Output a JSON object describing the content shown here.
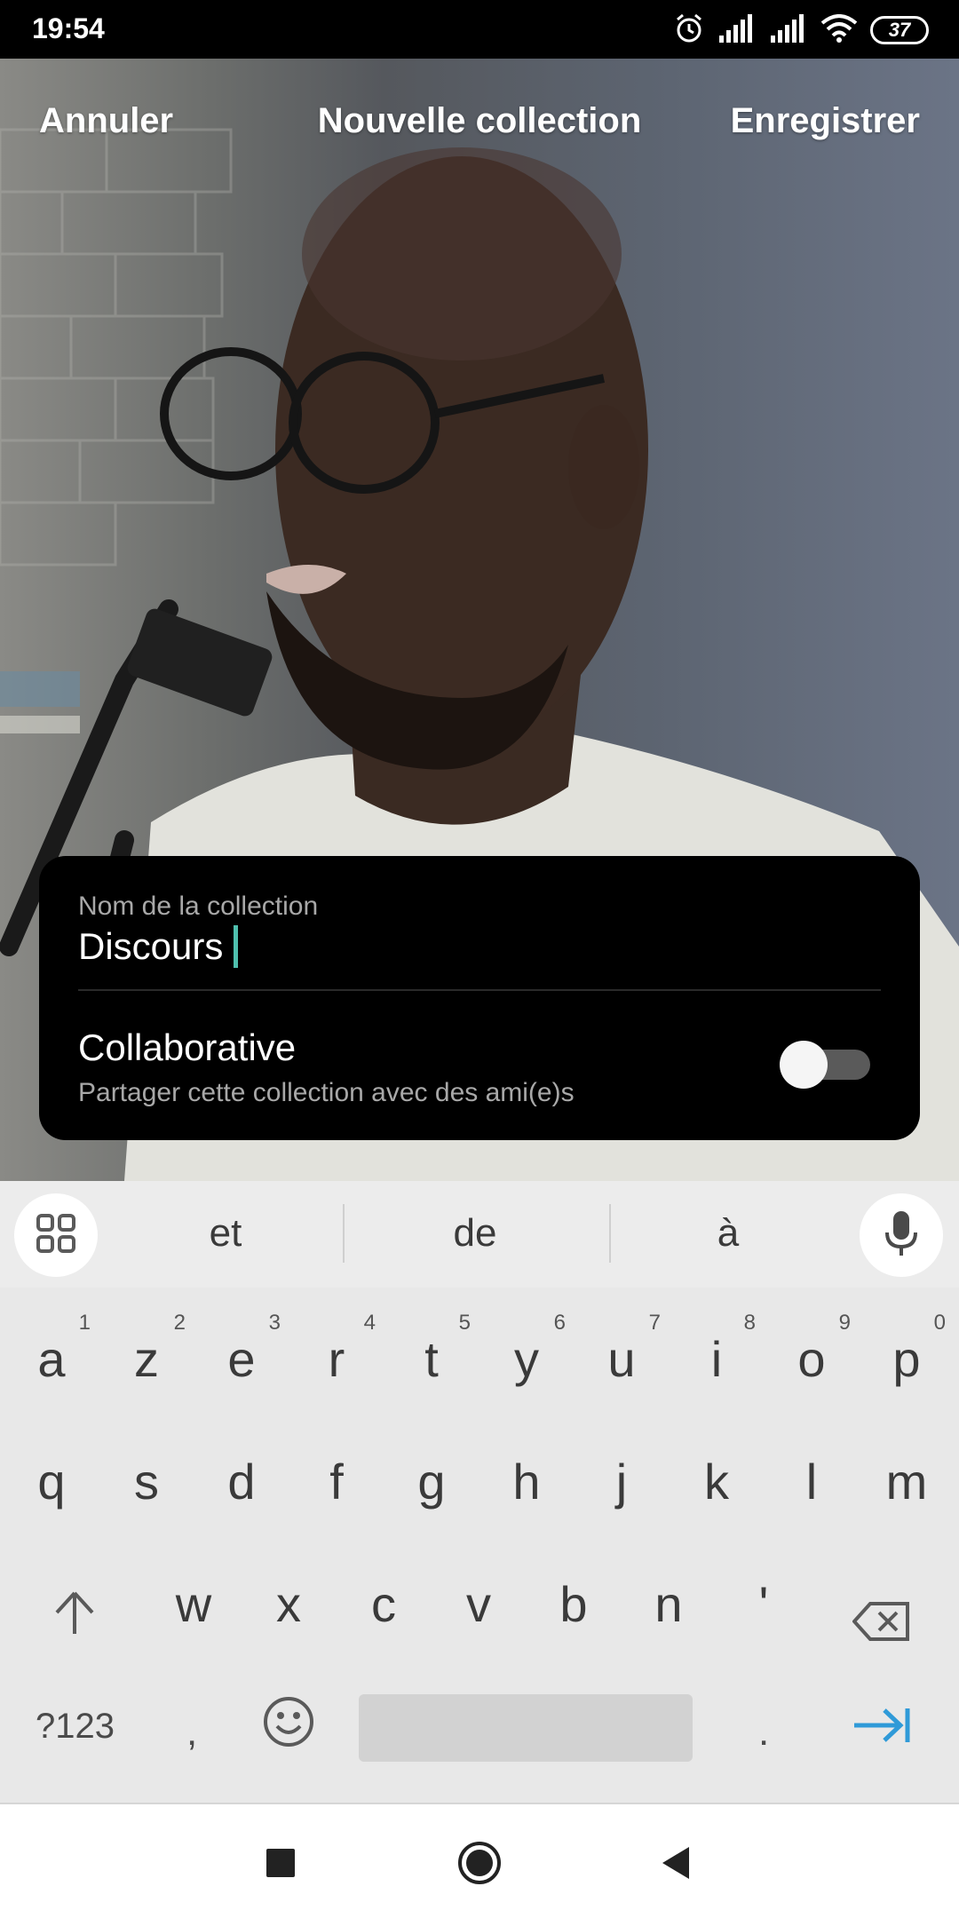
{
  "status_bar": {
    "time": "19:54",
    "battery": "37",
    "icons": [
      "alarm-icon",
      "signal-icon",
      "signal-icon",
      "wifi-icon",
      "battery-icon"
    ]
  },
  "header": {
    "cancel": "Annuler",
    "title": "Nouvelle collection",
    "save": "Enregistrer"
  },
  "form": {
    "name_label": "Nom de la collection",
    "name_value": "Discours",
    "collaborative_title": "Collaborative",
    "collaborative_sub": "Partager cette collection avec des ami(e)s",
    "collaborative_on": false
  },
  "keyboard": {
    "suggestions": [
      "et",
      "de",
      "à"
    ],
    "row1": [
      "a",
      "z",
      "e",
      "r",
      "t",
      "y",
      "u",
      "i",
      "o",
      "p"
    ],
    "row1_hints": [
      "1",
      "2",
      "3",
      "4",
      "5",
      "6",
      "7",
      "8",
      "9",
      "0"
    ],
    "row2": [
      "q",
      "s",
      "d",
      "f",
      "g",
      "h",
      "j",
      "k",
      "l",
      "m"
    ],
    "row3": [
      "w",
      "x",
      "c",
      "v",
      "b",
      "n",
      "'"
    ],
    "symbols_key": "?123",
    "comma_key": ",",
    "period_key": ".",
    "accent_color": "#2f9ad8"
  },
  "nav": {
    "icons": [
      "recents-icon",
      "home-icon",
      "back-icon"
    ]
  }
}
